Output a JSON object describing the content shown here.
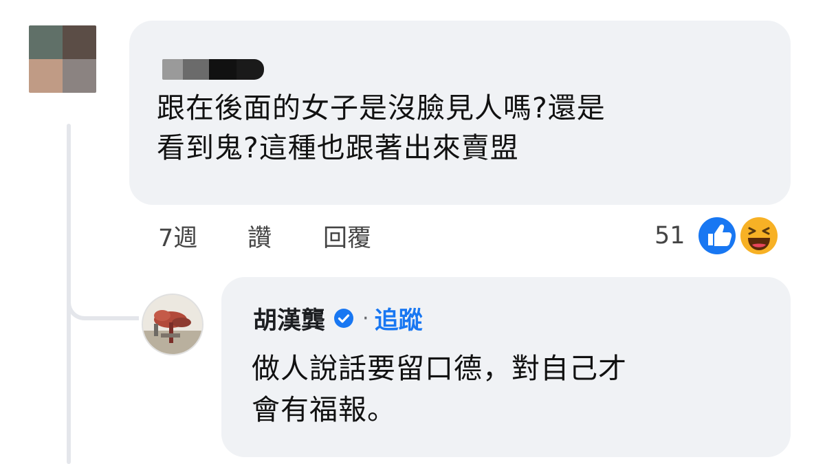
{
  "comment1": {
    "text": "跟在後面的女子是沒臉見人嗎?還是\n看到鬼?這種也跟著出來賣盟",
    "time": "7週",
    "like_label": "讚",
    "reply_label": "回覆",
    "reaction_count": "51",
    "reactions": [
      "like-icon",
      "haha-icon"
    ],
    "avatar_colors": [
      "#607068",
      "#5b4d46",
      "#c09b85",
      "#8b8381"
    ]
  },
  "reply1": {
    "author": "胡漢龔",
    "verified_icon": "verified-badge-icon",
    "separator": "·",
    "follow_label": "追蹤",
    "text": "做人說話要留口德，對自己才\n會有福報。"
  },
  "colors": {
    "bubble": "#f0f2f5",
    "link_blue": "#1877f2",
    "like_blue": "#1877f2",
    "haha_yellow": "#f7b125"
  }
}
